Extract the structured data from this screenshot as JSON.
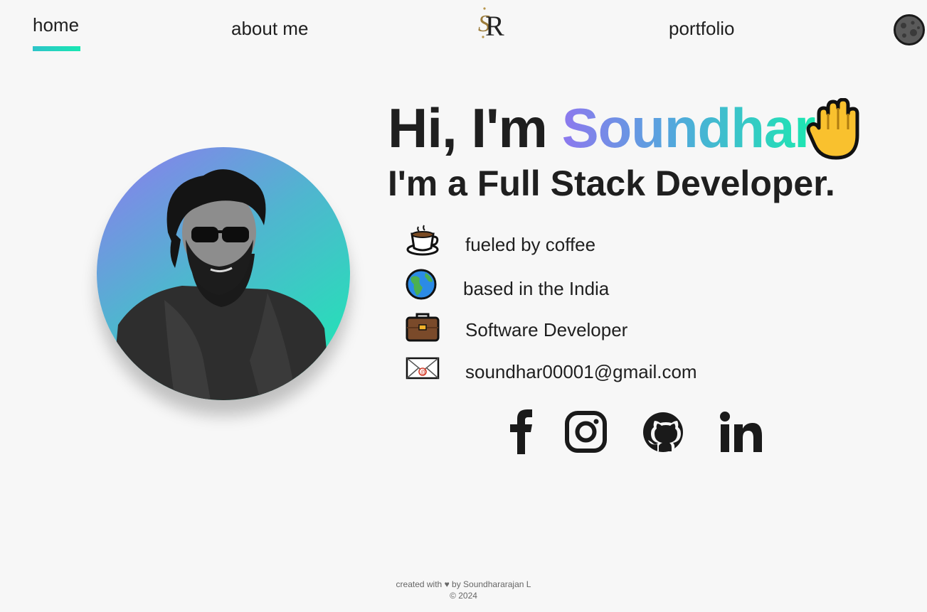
{
  "nav": {
    "home": "home",
    "about": "about me",
    "portfolio": "portfolio"
  },
  "hero": {
    "greeting_prefix": "Hi, I'm ",
    "name": "Soundhar",
    "role": "I'm a Full Stack Developer."
  },
  "facts": [
    {
      "icon": "coffee-icon",
      "text": "fueled by coffee"
    },
    {
      "icon": "globe-icon",
      "text": "based in the India"
    },
    {
      "icon": "briefcase-icon",
      "text": "Software Developer"
    },
    {
      "icon": "email-icon",
      "text": "soundhar00001@gmail.com"
    }
  ],
  "socials": [
    "facebook-icon",
    "instagram-icon",
    "github-icon",
    "linkedin-icon"
  ],
  "footer": {
    "line1": "created with ♥ by Soundhararajan L",
    "line2": "© 2024"
  },
  "colors": {
    "accent_start": "#8d78ee",
    "accent_mid": "#51a9dc",
    "accent_end": "#1ce8b0",
    "background": "#f7f7f7"
  }
}
